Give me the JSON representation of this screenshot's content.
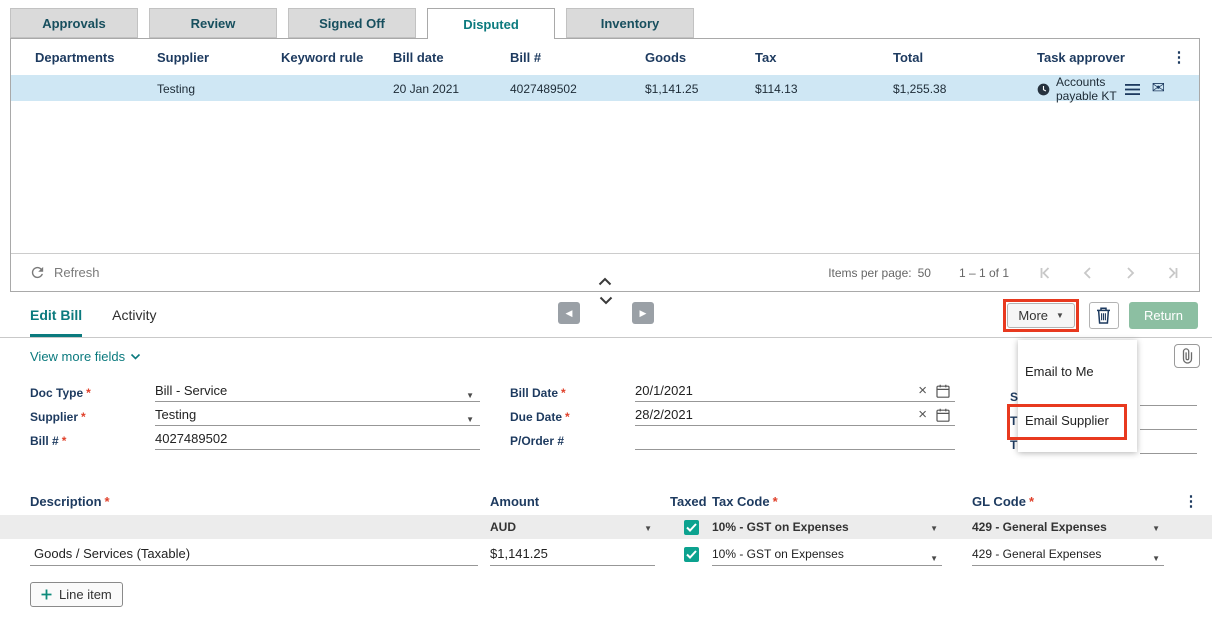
{
  "ui": {
    "required_marker": "*"
  },
  "colors": {
    "accent_teal": "#0b7a7e",
    "header_navy": "#1d3a5f",
    "selected_row_blue": "#cfe7f4",
    "annotation_red": "#e8391f",
    "return_button_green": "#8cbfa2",
    "checkbox_teal": "#0ca28f"
  },
  "tabs": {
    "items": [
      {
        "label": "Approvals",
        "active": false
      },
      {
        "label": "Review",
        "active": false
      },
      {
        "label": "Signed Off",
        "active": false
      },
      {
        "label": "Disputed",
        "active": true
      },
      {
        "label": "Inventory",
        "active": false
      }
    ]
  },
  "bills_table": {
    "headers": {
      "departments": "Departments",
      "supplier": "Supplier",
      "keyword_rule": "Keyword rule",
      "bill_date": "Bill date",
      "bill_number": "Bill #",
      "goods": "Goods",
      "tax": "Tax",
      "total": "Total",
      "task_approver": "Task approver"
    },
    "row": {
      "departments": "",
      "supplier": "Testing",
      "keyword_rule": "",
      "bill_date": "20 Jan 2021",
      "bill_number": "4027489502",
      "goods": "$1,141.25",
      "tax": "$114.13",
      "total": "$1,255.38",
      "task_approver": "Accounts payable KT"
    },
    "footer": {
      "refresh_label": "Refresh",
      "items_per_page_label": "Items per page:",
      "items_per_page_value": "50",
      "range": "1 – 1 of 1"
    }
  },
  "detail": {
    "tabs": {
      "edit_bill": "Edit Bill",
      "activity": "Activity"
    },
    "more_label": "More",
    "return_label": "Return",
    "menu": {
      "email_to_me": "Email to Me",
      "email_supplier": "Email Supplier"
    },
    "view_more_label": "View more fields",
    "form": {
      "doc_type": {
        "label": "Doc Type",
        "value": "Bill - Service"
      },
      "supplier": {
        "label": "Supplier",
        "value": "Testing"
      },
      "bill_number": {
        "label": "Bill #",
        "value": "4027489502"
      },
      "bill_date": {
        "label": "Bill Date",
        "value": "20/1/2021"
      },
      "due_date": {
        "label": "Due Date",
        "value": "28/2/2021"
      },
      "purchase_order": {
        "label": "P/Order #",
        "value": ""
      },
      "summary_partial": [
        "S",
        "T",
        "T"
      ]
    },
    "line_items": {
      "headers": {
        "description": "Description",
        "amount": "Amount",
        "taxed": "Taxed",
        "tax_code": "Tax Code",
        "gl_code": "GL Code"
      },
      "defaults": {
        "currency": "AUD",
        "tax_code": "10% - GST on Expenses",
        "gl_code": "429 - General Expenses"
      },
      "rows": [
        {
          "description": "Goods / Services (Taxable)",
          "amount": "$1,141.25",
          "taxed": true,
          "tax_code": "10% - GST on Expenses",
          "gl_code": "429 - General Expenses"
        }
      ],
      "add_line_label": "Line item"
    }
  }
}
